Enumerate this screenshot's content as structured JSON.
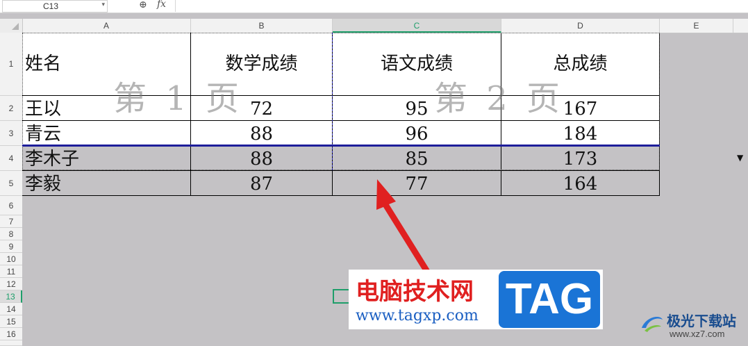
{
  "toolbar": {
    "name_box": "C13",
    "fx": "fx",
    "formula": ""
  },
  "columns": [
    "A",
    "B",
    "C",
    "D",
    "E"
  ],
  "rows": [
    "1",
    "2",
    "3",
    "4",
    "5",
    "6",
    "7",
    "8",
    "9",
    "10",
    "11",
    "12",
    "13",
    "14",
    "15",
    "16"
  ],
  "selected": {
    "column": "C",
    "row": "13"
  },
  "table": {
    "headers": [
      "姓名",
      "数学成绩",
      "语文成绩",
      "总成绩"
    ],
    "records": [
      [
        "王以",
        "72",
        "95",
        "167"
      ],
      [
        "青云",
        "88",
        "96",
        "184"
      ],
      [
        "李木子",
        "88",
        "85",
        "173"
      ],
      [
        "李毅",
        "87",
        "77",
        "164"
      ]
    ]
  },
  "watermarks": [
    "第 1 页",
    "第 2 页"
  ],
  "overlay": {
    "logo_cn": "电脑技术网",
    "logo_url": "www.tagxp.com",
    "logo_tag": "TAG",
    "brand_cn": "极光下载站",
    "brand_url": "www.xz7.com",
    "stray_text": "▼"
  },
  "colors": {
    "selection": "#1e9e6a",
    "page_break": "#1d1d9a",
    "arrow": "#e02020",
    "tag_bg": "#1a74d6"
  }
}
